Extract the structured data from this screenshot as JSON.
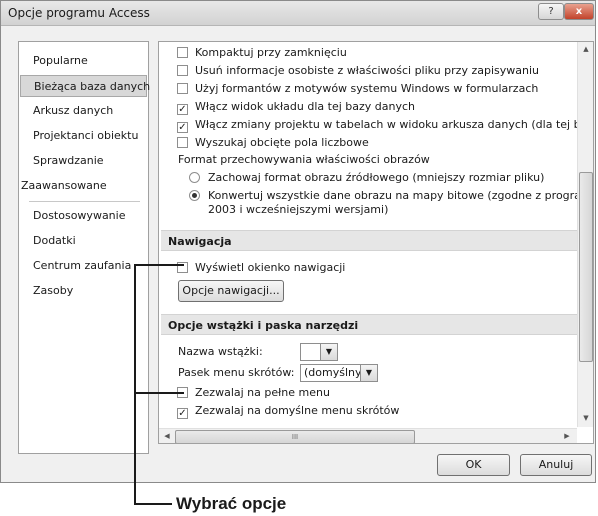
{
  "window": {
    "title": "Opcje programu Access",
    "help_label": "?",
    "close_label": "x"
  },
  "nav": {
    "items": [
      {
        "label": "Popularne"
      },
      {
        "label": "Bieżąca baza danych",
        "selected": true
      },
      {
        "label": "Arkusz danych"
      },
      {
        "label": "Projektanci obiektu"
      },
      {
        "label": "Sprawdzanie"
      },
      {
        "label": "Zaawansowane"
      },
      {
        "label": "Dostosowywanie"
      },
      {
        "label": "Dodatki"
      },
      {
        "label": "Centrum zaufania"
      },
      {
        "label": "Zasoby"
      }
    ]
  },
  "content": {
    "options": [
      {
        "label": "Kompaktuj przy zamknięciu",
        "checked": false
      },
      {
        "label": "Usuń informacje osobiste z właściwości pliku przy zapisywaniu",
        "checked": false
      },
      {
        "label": "Użyj formantów z motywów systemu Windows w formularzach",
        "checked": false
      },
      {
        "label": "Włącz widok układu dla tej bazy danych",
        "checked": true
      },
      {
        "label": "Włącz zmiany projektu w tabelach w widoku arkusza danych (dla tej bazy da",
        "checked": true
      },
      {
        "label": "Wyszukaj obcięte pola liczbowe",
        "checked": false
      }
    ],
    "picture_format": {
      "label": "Format przechowywania właściwości obrazów",
      "option1": "Zachowaj format obrazu źródłowego (mniejszy rozmiar pliku)",
      "option2_line1": "Konwertuj wszystkie dane obrazu na mapy bitowe (zgodne z programem",
      "option2_line2": "2003 i wcześniejszymi wersjami)",
      "selected": 2
    },
    "navigation_section": {
      "title": "Nawigacja",
      "show_nav_pane": "Wyświetl okienko nawigacji",
      "show_nav_pane_checked": false,
      "nav_options_button": "Opcje nawigacji..."
    },
    "ribbon_section": {
      "title": "Opcje wstążki i paska narzędzi",
      "ribbon_name_label": "Nazwa wstążki:",
      "ribbon_name_value": "",
      "shortcut_menu_label": "Pasek menu skrótów:",
      "shortcut_menu_value": "(domyślny)",
      "full_menus": "Zezwalaj na pełne menu",
      "full_menus_checked": false,
      "default_shortcut": "Zezwalaj na domyślne menu skrótów",
      "default_shortcut_checked": true
    },
    "scroll_thumb_glyph": "III"
  },
  "buttons": {
    "ok": "OK",
    "cancel": "Anuluj"
  },
  "annotation": {
    "label": "Wybrać opcje"
  }
}
